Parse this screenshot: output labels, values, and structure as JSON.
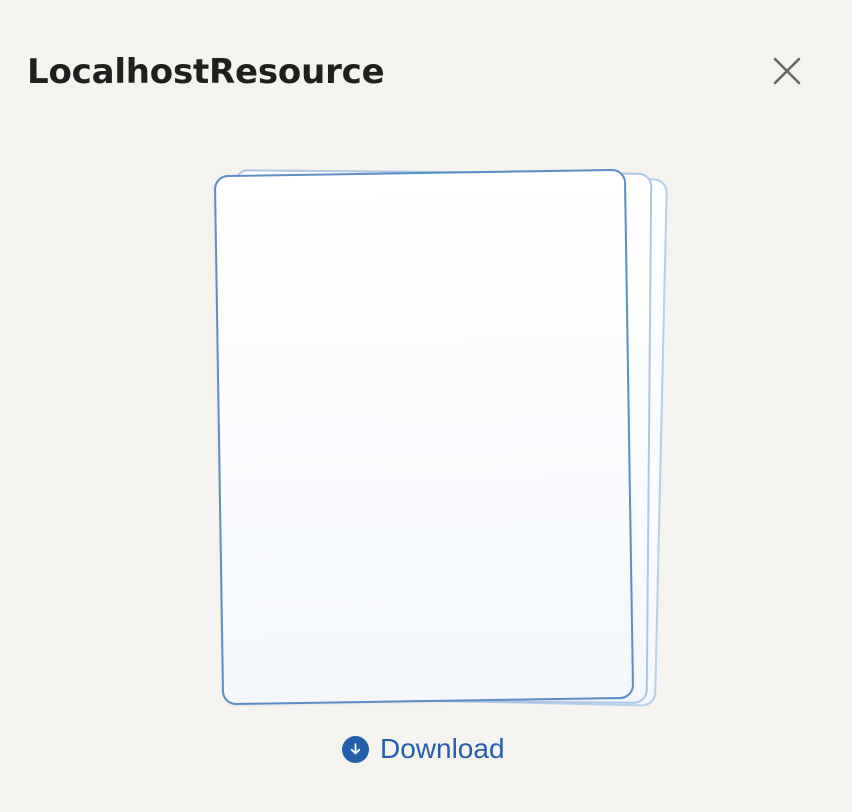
{
  "modal": {
    "title": "LocalhostResource"
  },
  "controls": {
    "close_icon": "close-icon",
    "download_label": "Download",
    "download_icon": "download-circle-icon"
  },
  "preview": {
    "type": "stacked-document-placeholder",
    "visible_pages": 3
  },
  "colors": {
    "background": "#f4f3ef",
    "title": "#1f1f1d",
    "accent": "#245faa",
    "preview_border": "#5b8ec7"
  }
}
